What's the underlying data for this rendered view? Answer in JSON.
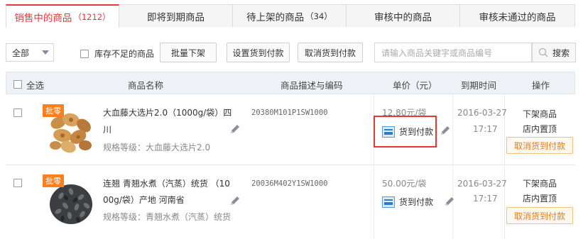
{
  "tabs": [
    {
      "label": "销售中的商品",
      "count": "（1212）",
      "active": true
    },
    {
      "label": "即将到期商品",
      "count": "",
      "active": false
    },
    {
      "label": "待上架的商品",
      "count": "（34）",
      "active": false
    },
    {
      "label": "审核中的商品",
      "count": "",
      "active": false
    },
    {
      "label": "审核未通过的商品",
      "count": "",
      "active": false
    }
  ],
  "toolbar": {
    "filter_value": "全部",
    "low_stock_label": "库存不足的商品",
    "batch_off_label": "批量下架",
    "set_cod_label": "设置货到付款",
    "cancel_cod_label": "取消货到付款",
    "search_placeholder": "请输入商品关键字或商品编号",
    "search_label": "搜索"
  },
  "table": {
    "headers": {
      "select_all": "全选",
      "name": "商品名称",
      "desc": "商品描述与编码",
      "price": "单价（元）",
      "expiry": "到期时间",
      "ops": "操作"
    },
    "rows": [
      {
        "badge": "批零",
        "name_line1": "大血藤大选片2.0（1000g/袋）四",
        "name_line2": "川",
        "spec": "规格等级：大血藤大选片2.0",
        "code": "20380M101P1SW1000",
        "price": "12.80元/袋",
        "cod_label": "货到付款",
        "date": "2016-03-27",
        "time": "17:17",
        "op_delist": "下架商品",
        "op_pin": "店内置顶",
        "op_cancel_cod": "取消货到付款"
      },
      {
        "badge": "批零",
        "name_line1": "连翘 青翘水煮（汽蒸）统货 （10",
        "name_line2": "00g/袋）产地 河南省",
        "spec": "规格等级：青翘水煮（汽蒸）统货",
        "code": "20036M402Y1SW1000",
        "price": "50.00元/袋",
        "cod_label": "货到付款",
        "date": "2016-03-27",
        "time": "17:17",
        "op_delist": "下架商品",
        "op_pin": "店内置顶",
        "op_cancel_cod": "取消货到付款"
      }
    ]
  },
  "colors": {
    "accent": "#e4393c",
    "badge": "#ff7f1a",
    "highlight_box": "#e8372f"
  }
}
